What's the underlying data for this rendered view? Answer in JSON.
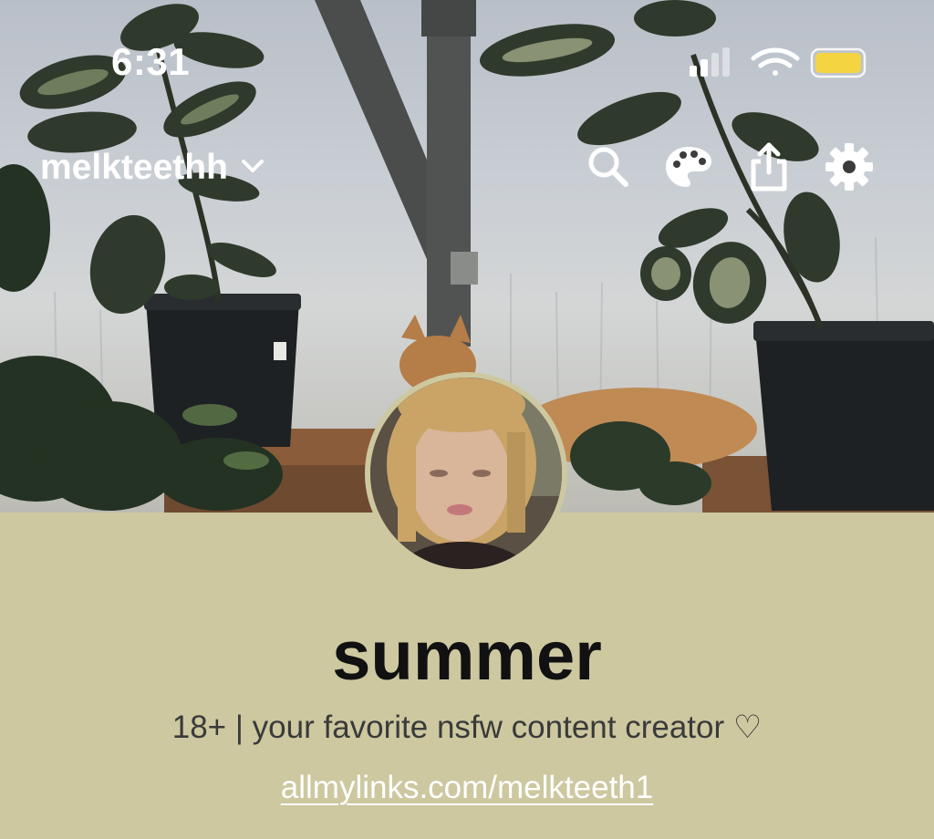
{
  "status_bar": {
    "time": "6:31",
    "icons": [
      "signal-icon",
      "wifi-icon",
      "battery-icon"
    ],
    "battery_color": "#f5d442"
  },
  "top_bar": {
    "username": "melkteethh",
    "dropdown_icon": "chevron-down-icon",
    "actions": [
      "search-icon",
      "palette-icon",
      "share-icon",
      "settings-icon"
    ]
  },
  "profile": {
    "display_name": "summer",
    "bio": "18+ | your favorite nsfw content creator ♡",
    "link": "allmylinks.com/melkteeth1"
  },
  "colors": {
    "background": "#cdc8a0",
    "name_text": "#111111",
    "bio_text": "#3a3a3a",
    "link_text": "#ffffff"
  }
}
